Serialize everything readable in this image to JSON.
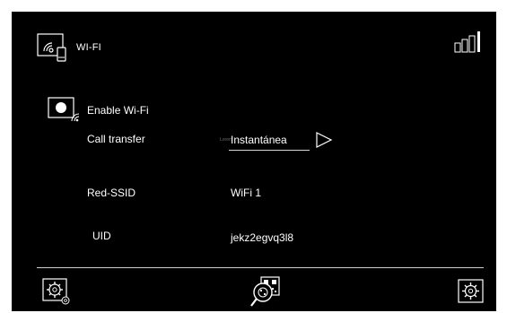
{
  "header": {
    "title": "WI-FI",
    "icon": "wifi-phone-icon",
    "signal_icon": "signal-bars-icon"
  },
  "wifi": {
    "enable_label": "Enable Wi-Fi",
    "toggle_icon": "toggle-wifi-icon"
  },
  "rows": {
    "call_transfer": {
      "label": "Call transfer",
      "tiny_text": "Lorem",
      "value": "Instantánea",
      "arrow_icon": "play-arrow-icon"
    },
    "ssid": {
      "label": "Red-SSID",
      "value": "WiFi 1"
    },
    "uid": {
      "label": "UID",
      "value": "jekz2egvq3l8"
    }
  },
  "footer": {
    "left_icon": "settings-gear-icon",
    "center_icon": "qr-search-icon",
    "right_icon": "settings-icon"
  },
  "colors": {
    "background": "#000000",
    "text": "#ffffff",
    "frame": "#ffffff"
  }
}
